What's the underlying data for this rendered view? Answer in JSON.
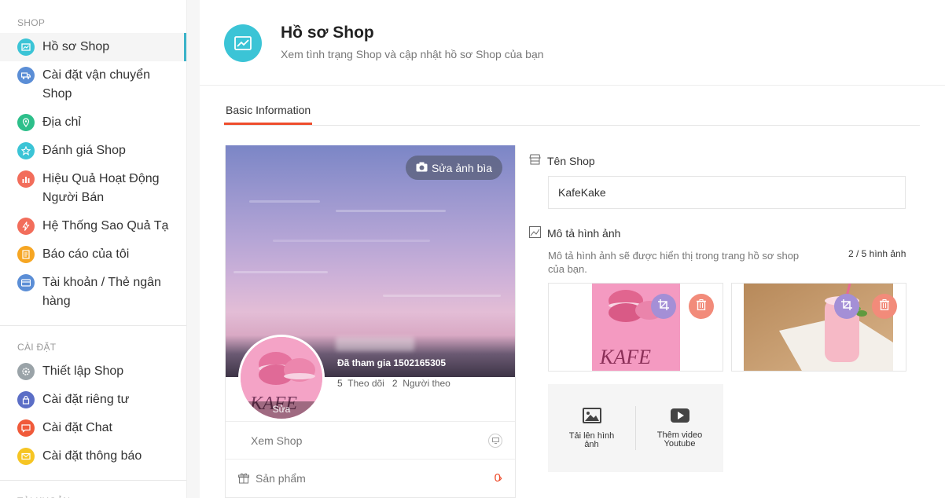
{
  "sidebar": {
    "section_shop": "SHOP",
    "shop_items": [
      {
        "label": "Hồ sơ Shop",
        "icon": "shop-profile-icon",
        "color": "#3bc4d6",
        "active": true
      },
      {
        "label": "Cài đặt vận chuyển Shop",
        "icon": "truck-icon",
        "color": "#5b8ed6"
      },
      {
        "label": "Địa chỉ",
        "icon": "location-pin-icon",
        "color": "#2dbf8a"
      },
      {
        "label": "Đánh giá Shop",
        "icon": "star-icon",
        "color": "#3bc4d6"
      },
      {
        "label": "Hiệu Quả Hoạt Động Người Bán",
        "icon": "bar-chart-icon",
        "color": "#f26d5b"
      },
      {
        "label": "Hệ Thống Sao Quả Tạ",
        "icon": "lightning-icon",
        "color": "#f26d5b"
      },
      {
        "label": "Báo cáo của tôi",
        "icon": "report-icon",
        "color": "#f6a623"
      },
      {
        "label": "Tài khoản / Thẻ ngân hàng",
        "icon": "bank-card-icon",
        "color": "#5b8ed6"
      }
    ],
    "section_settings": "CÀI ĐẶT",
    "settings_items": [
      {
        "label": "Thiết lập Shop",
        "icon": "gear-icon",
        "color": "#9aa3a8"
      },
      {
        "label": "Cài đặt riêng tư",
        "icon": "lock-icon",
        "color": "#5b6ec6"
      },
      {
        "label": "Cài đặt Chat",
        "icon": "chat-icon",
        "color": "#f05a3a"
      },
      {
        "label": "Cài đặt thông báo",
        "icon": "notification-icon",
        "color": "#f6c523"
      }
    ],
    "section_account": "TÀI KHOẢN"
  },
  "header": {
    "title": "Hồ sơ Shop",
    "subtitle": "Xem tình trạng Shop và cập nhật hồ sơ Shop của bạn"
  },
  "tabs": {
    "active_label": "Basic Information"
  },
  "cover_card": {
    "edit_cover_label": "Sửa ảnh bìa",
    "avatar_edit_label": "Sửa",
    "joined_label": "Đã tham gia 1502165305",
    "following_count": "5",
    "following_label": "Theo dõi",
    "followers_count": "2",
    "followers_label": "Người theo",
    "view_shop_label": "Xem Shop",
    "products_label": "Sản phẩm",
    "products_count": "0"
  },
  "form": {
    "shop_name_label": "Tên Shop",
    "shop_name_value": "KafeKake",
    "image_desc_label": "Mô tả hình ảnh",
    "image_desc_help": "Mô tả hình ảnh sẽ được hiển thị trong trang hồ sơ shop của bạn.",
    "image_count": "2 / 5 hình ảnh",
    "upload_image_label": "Tải lên hình ảnh",
    "add_video_label": "Thêm video Youtube"
  },
  "colors": {
    "accent": "#ee4d2d",
    "header_icon": "#3bc4d6",
    "crop_button": "#a48fd6",
    "delete_button": "#f28b7a"
  }
}
